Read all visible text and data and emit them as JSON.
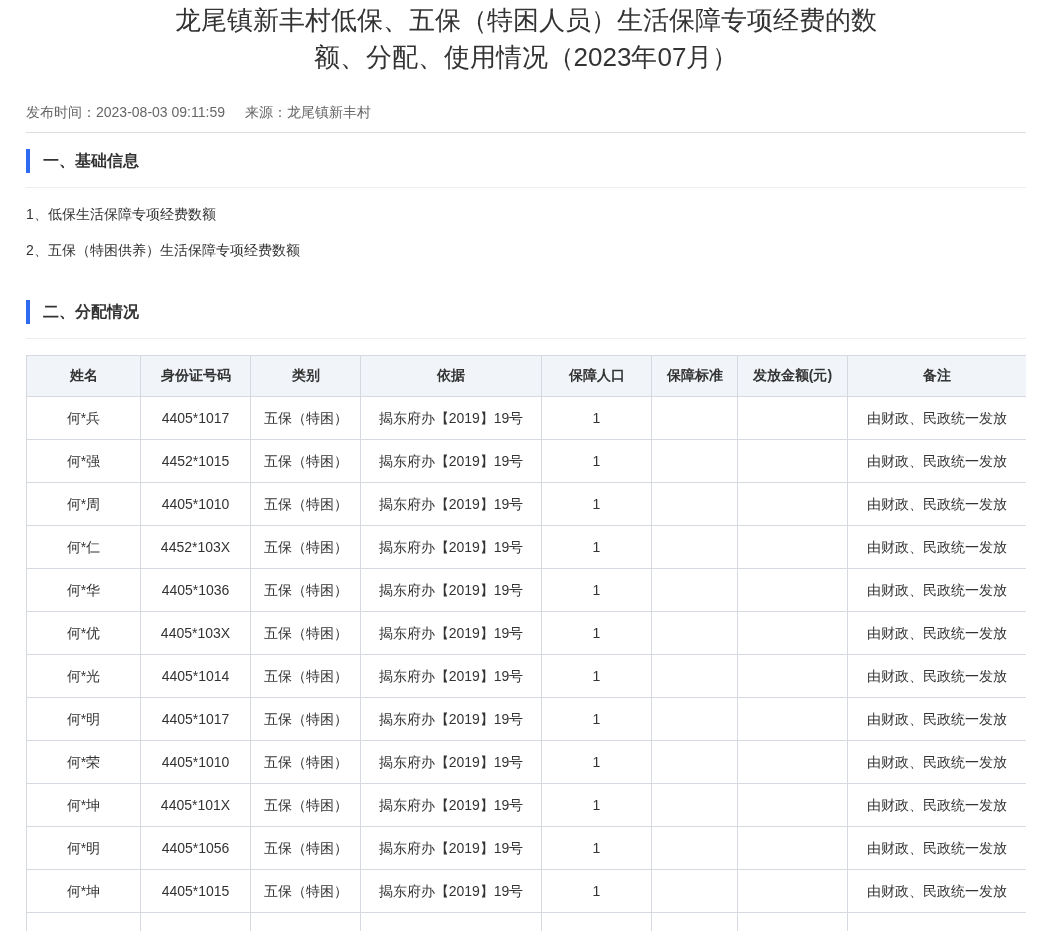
{
  "title": [
    "龙尾镇新丰村低保、五保（特困人员）生活保障专项经费的数",
    "额、分配、使用情况（2023年07月）"
  ],
  "meta": {
    "publish_time": "发布时间：2023-08-03 09:11:59",
    "source": "来源：龙尾镇新丰村"
  },
  "section_1": {
    "heading": "一、基础信息",
    "items": [
      "1、低保生活保障专项经费数额",
      "2、五保（特困供养）生活保障专项经费数额"
    ]
  },
  "section_2": {
    "heading": "二、分配情况"
  },
  "table": {
    "columns": [
      "姓名",
      "身份证号码",
      "类别",
      "依据",
      "保障人口",
      "保障标准",
      "发放金额(元)",
      "备注"
    ],
    "rows": [
      {
        "name": "何*兵",
        "id": "4405*1017",
        "category": "五保（特困）",
        "basis": "揭东府办【2019】19号",
        "population": "1",
        "note": "由财政、民政统一发放"
      },
      {
        "name": "何*强",
        "id": "4452*1015",
        "category": "五保（特困）",
        "basis": "揭东府办【2019】19号",
        "population": "1",
        "note": "由财政、民政统一发放"
      },
      {
        "name": "何*周",
        "id": "4405*1010",
        "category": "五保（特困）",
        "basis": "揭东府办【2019】19号",
        "population": "1",
        "note": "由财政、民政统一发放"
      },
      {
        "name": "何*仁",
        "id": "4452*103X",
        "category": "五保（特困）",
        "basis": "揭东府办【2019】19号",
        "population": "1",
        "note": "由财政、民政统一发放"
      },
      {
        "name": "何*华",
        "id": "4405*1036",
        "category": "五保（特困）",
        "basis": "揭东府办【2019】19号",
        "population": "1",
        "note": "由财政、民政统一发放"
      },
      {
        "name": "何*优",
        "id": "4405*103X",
        "category": "五保（特困）",
        "basis": "揭东府办【2019】19号",
        "population": "1",
        "note": "由财政、民政统一发放"
      },
      {
        "name": "何*光",
        "id": "4405*1014",
        "category": "五保（特困）",
        "basis": "揭东府办【2019】19号",
        "population": "1",
        "note": "由财政、民政统一发放"
      },
      {
        "name": "何*明",
        "id": "4405*1017",
        "category": "五保（特困）",
        "basis": "揭东府办【2019】19号",
        "population": "1",
        "note": "由财政、民政统一发放"
      },
      {
        "name": "何*荣",
        "id": "4405*1010",
        "category": "五保（特困）",
        "basis": "揭东府办【2019】19号",
        "population": "1",
        "note": "由财政、民政统一发放"
      },
      {
        "name": "何*坤",
        "id": "4405*101X",
        "category": "五保（特困）",
        "basis": "揭东府办【2019】19号",
        "population": "1",
        "note": "由财政、民政统一发放"
      },
      {
        "name": "何*明",
        "id": "4405*1056",
        "category": "五保（特困）",
        "basis": "揭东府办【2019】19号",
        "population": "1",
        "note": "由财政、民政统一发放"
      },
      {
        "name": "何*坤",
        "id": "4405*1015",
        "category": "五保（特困）",
        "basis": "揭东府办【2019】19号",
        "population": "1",
        "note": "由财政、民政统一发放"
      }
    ]
  }
}
